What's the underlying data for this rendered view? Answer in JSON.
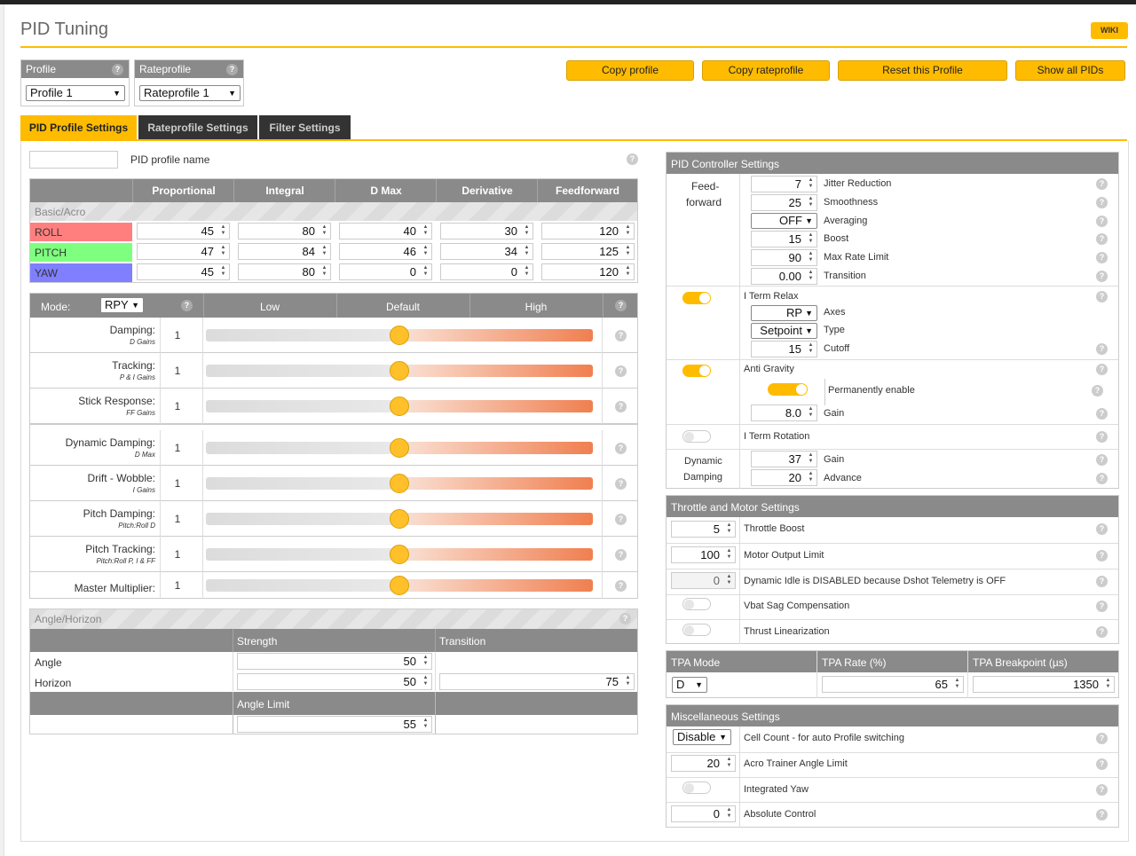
{
  "page": {
    "title": "PID Tuning",
    "wiki": "WIKI"
  },
  "profile": {
    "label": "Profile",
    "value": "Profile 1"
  },
  "rateprofile": {
    "label": "Rateprofile",
    "value": "Rateprofile 1"
  },
  "buttons": {
    "copy_profile": "Copy profile",
    "copy_rateprofile": "Copy rateprofile",
    "reset_profile": "Reset this Profile",
    "show_all": "Show all PIDs"
  },
  "tabs": [
    {
      "label": "PID Profile Settings",
      "active": true
    },
    {
      "label": "Rateprofile Settings",
      "active": false
    },
    {
      "label": "Filter Settings",
      "active": false
    }
  ],
  "pid_profile_name": {
    "label": "PID profile name",
    "value": ""
  },
  "pid_table": {
    "headers": [
      "Proportional",
      "Integral",
      "D Max",
      "Derivative",
      "Feedforward"
    ],
    "group": "Basic/Acro",
    "rows": [
      {
        "axis": "ROLL",
        "color": "#ff7f7f",
        "values": [
          "45",
          "80",
          "40",
          "30",
          "120"
        ]
      },
      {
        "axis": "PITCH",
        "color": "#7fff7f",
        "values": [
          "47",
          "84",
          "46",
          "34",
          "125"
        ]
      },
      {
        "axis": "YAW",
        "color": "#7f7fff",
        "values": [
          "45",
          "80",
          "0",
          "0",
          "120"
        ]
      }
    ]
  },
  "sliders": {
    "mode_label": "Mode:",
    "mode_value": "RPY",
    "headers": [
      "Low",
      "Default",
      "High"
    ],
    "items": [
      {
        "label": "Damping:",
        "sub": "D Gains",
        "value": "1",
        "position": 0.5
      },
      {
        "label": "Tracking:",
        "sub": "P & I Gains",
        "value": "1",
        "position": 0.5
      },
      {
        "label": "Stick Response:",
        "sub": "FF Gains",
        "value": "1",
        "position": 0.5
      },
      {
        "label": "Dynamic Damping:",
        "sub": "D Max",
        "value": "1",
        "position": 0.5
      },
      {
        "label": "Drift - Wobble:",
        "sub": "I Gains",
        "value": "1",
        "position": 0.5
      },
      {
        "label": "Pitch Damping:",
        "sub": "Pitch:Roll D",
        "value": "1",
        "position": 0.5
      },
      {
        "label": "Pitch Tracking:",
        "sub": "Pitch:Roll P, I & FF",
        "value": "1",
        "position": 0.5
      },
      {
        "label": "Master Multiplier:",
        "sub": "",
        "value": "1",
        "position": 0.5
      }
    ]
  },
  "angle_horizon": {
    "title": "Angle/Horizon",
    "strength": "Strength",
    "transition": "Transition",
    "angle_label": "Angle",
    "angle_strength": "50",
    "horizon_label": "Horizon",
    "horizon_strength": "50",
    "horizon_transition": "75",
    "angle_limit_label": "Angle Limit",
    "angle_limit": "55"
  },
  "pid_controller": {
    "title": "PID Controller Settings",
    "ff_label1": "Feed-",
    "ff_label2": "forward",
    "jitter": {
      "value": "7",
      "label": "Jitter Reduction"
    },
    "smoothness": {
      "value": "25",
      "label": "Smoothness"
    },
    "averaging": {
      "value": "OFF",
      "label": "Averaging"
    },
    "boost": {
      "value": "15",
      "label": "Boost"
    },
    "max_rate": {
      "value": "90",
      "label": "Max Rate Limit"
    },
    "transition": {
      "value": "0.00",
      "label": "Transition"
    },
    "iterm_relax": {
      "label": "I Term Relax",
      "on": true
    },
    "axes": {
      "value": "RP",
      "label": "Axes"
    },
    "type": {
      "value": "Setpoint",
      "label": "Type"
    },
    "cutoff": {
      "value": "15",
      "label": "Cutoff"
    },
    "anti_gravity": {
      "label": "Anti Gravity",
      "on": true
    },
    "perm": {
      "label": "Permanently enable",
      "on": true
    },
    "ag_gain": {
      "value": "8.0",
      "label": "Gain"
    },
    "iterm_rotation": {
      "label": "I Term Rotation",
      "on": false
    },
    "dyn_label1": "Dynamic",
    "dyn_label2": "Damping",
    "dyn_gain": {
      "value": "37",
      "label": "Gain"
    },
    "dyn_advance": {
      "value": "20",
      "label": "Advance"
    }
  },
  "throttle": {
    "title": "Throttle and Motor Settings",
    "boost": {
      "value": "5",
      "label": "Throttle Boost"
    },
    "output": {
      "value": "100",
      "label": "Motor Output Limit"
    },
    "idle": {
      "value": "0",
      "label": "Dynamic Idle is DISABLED because Dshot Telemetry is OFF"
    },
    "vbat": {
      "label": "Vbat Sag Compensation",
      "on": false
    },
    "thrust": {
      "label": "Thrust Linearization",
      "on": false
    }
  },
  "tpa": {
    "mode_label": "TPA Mode",
    "rate_label": "TPA Rate (%)",
    "bp_label": "TPA Breakpoint (µs)",
    "mode": "D",
    "rate": "65",
    "bp": "1350"
  },
  "misc": {
    "title": "Miscellaneous Settings",
    "cell": {
      "value": "Disable",
      "label": "Cell Count - for auto Profile switching"
    },
    "acro": {
      "value": "20",
      "label": "Acro Trainer Angle Limit"
    },
    "yaw": {
      "label": "Integrated Yaw",
      "on": false
    },
    "abs": {
      "value": "0",
      "label": "Absolute Control"
    }
  },
  "colors": {
    "accent": "#ffbb00",
    "header_gray": "#8a8a8a"
  }
}
